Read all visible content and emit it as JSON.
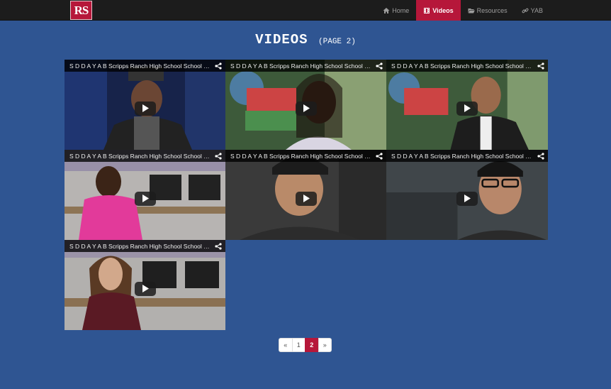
{
  "brand": {
    "logo_text": "RS"
  },
  "nav": {
    "items": [
      {
        "label": "Home",
        "icon": "home-icon",
        "active": false
      },
      {
        "label": "Videos",
        "icon": "film-icon",
        "active": true
      },
      {
        "label": "Resources",
        "icon": "folder-open-icon",
        "active": false
      },
      {
        "label": "YAB",
        "icon": "link-icon",
        "active": false
      }
    ]
  },
  "page": {
    "title": "VIDEOS",
    "subtitle": "(PAGE 2)"
  },
  "videos": [
    {
      "title": "S D D A Y A B Scripps Ranch High School School Campus"
    },
    {
      "title": "S D D A Y A B Scripps Ranch High School School Campus"
    },
    {
      "title": "S D D A Y A B Scripps Ranch High School School Campus"
    },
    {
      "title": "S D D A Y A B Scripps Ranch High School School Campus"
    },
    {
      "title": "S D D A Y A B Scripps Ranch High School School Campus"
    },
    {
      "title": "S D D A Y A B Scripps Ranch High School School Campus"
    },
    {
      "title": "S D D A Y A B Scripps Ranch High School School Campus"
    }
  ],
  "pagination": {
    "prev": "«",
    "pages": [
      "1",
      "2"
    ],
    "current": "2",
    "next": "»"
  },
  "colors": {
    "background": "#2f5592",
    "navbar": "#1c1c1c",
    "accent": "#b6173a"
  }
}
